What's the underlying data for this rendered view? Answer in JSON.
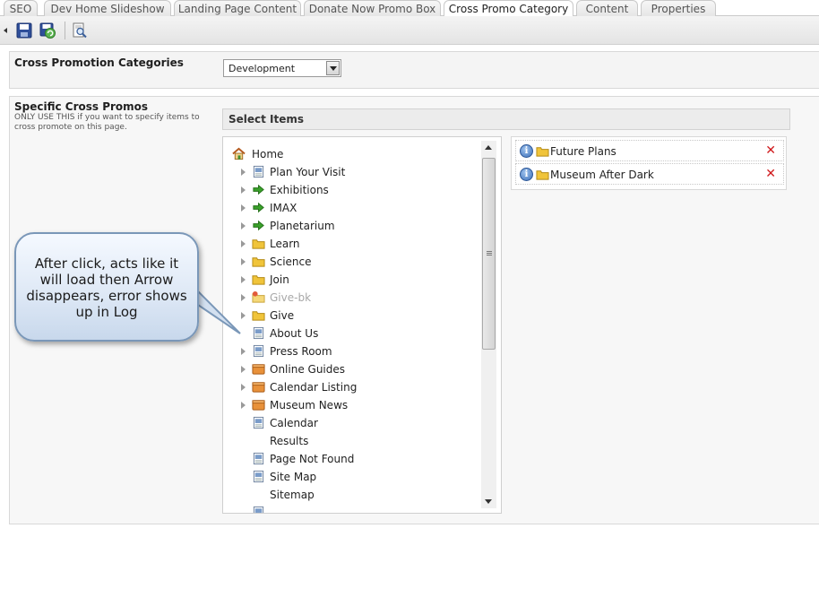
{
  "tabs": [
    {
      "label": "SEO",
      "active": false
    },
    {
      "label": "Dev Home Slideshow",
      "active": false
    },
    {
      "label": "Landing Page Content",
      "active": false
    },
    {
      "label": "Donate Now Promo Box",
      "active": false
    },
    {
      "label": "Cross Promo Category",
      "active": true
    },
    {
      "label": "Content",
      "active": false
    },
    {
      "label": "Properties",
      "active": false
    }
  ],
  "toolbar": {
    "icons": [
      "collapse-arrow-icon",
      "save-icon",
      "save-publish-icon",
      "preview-icon"
    ]
  },
  "categories_panel": {
    "label": "Cross Promotion Categories",
    "selected_value": "Development"
  },
  "specific_panel": {
    "label": "Specific Cross Promos",
    "hint": "ONLY USE THIS if you want to specify items to cross promote on this page.",
    "select_items_label": "Select Items"
  },
  "tree": {
    "root": {
      "label": "Home",
      "icon": "home-icon"
    },
    "items": [
      {
        "label": "Plan Your Visit",
        "icon": "page-icon",
        "expandable": true,
        "disabled": false
      },
      {
        "label": "Exhibitions",
        "icon": "green-arrow-icon",
        "expandable": true,
        "disabled": false
      },
      {
        "label": "IMAX",
        "icon": "green-arrow-icon",
        "expandable": true,
        "disabled": false
      },
      {
        "label": "Planetarium",
        "icon": "green-arrow-icon",
        "expandable": true,
        "disabled": false
      },
      {
        "label": "Learn",
        "icon": "folder-icon",
        "expandable": true,
        "disabled": false
      },
      {
        "label": "Science",
        "icon": "folder-icon",
        "expandable": true,
        "disabled": false
      },
      {
        "label": "Join",
        "icon": "folder-icon",
        "expandable": true,
        "disabled": false
      },
      {
        "label": "Give-bk",
        "icon": "folder-new-icon",
        "expandable": true,
        "disabled": true
      },
      {
        "label": "Give",
        "icon": "folder-icon",
        "expandable": true,
        "disabled": false
      },
      {
        "label": "About Us",
        "icon": "page-icon",
        "expandable": false,
        "disabled": false
      },
      {
        "label": "Press Room",
        "icon": "page-icon",
        "expandable": true,
        "disabled": false
      },
      {
        "label": "Online Guides",
        "icon": "box-icon",
        "expandable": true,
        "disabled": false
      },
      {
        "label": "Calendar Listing",
        "icon": "box-icon",
        "expandable": true,
        "disabled": false
      },
      {
        "label": "Museum News",
        "icon": "box-icon",
        "expandable": true,
        "disabled": false
      },
      {
        "label": "Calendar",
        "icon": "page-icon",
        "expandable": false,
        "disabled": false
      },
      {
        "label": "Results",
        "icon": "",
        "expandable": false,
        "disabled": false
      },
      {
        "label": "Page Not Found",
        "icon": "page-icon",
        "expandable": false,
        "disabled": false
      },
      {
        "label": "Site Map",
        "icon": "page-icon",
        "expandable": false,
        "disabled": false
      },
      {
        "label": "Sitemap",
        "icon": "",
        "expandable": false,
        "disabled": false
      }
    ]
  },
  "selected_items": [
    {
      "label": "Future Plans",
      "icon": "folder-icon"
    },
    {
      "label": "Museum After Dark",
      "icon": "folder-icon"
    }
  ],
  "callout": {
    "text": "After click, acts like it will load then Arrow disappears, error shows up in Log"
  },
  "colors": {
    "remove_x": "#d0191c",
    "callout_border": "#7a97b8",
    "green_arrow": "#3aa12b",
    "folder": "#f0c43a"
  }
}
